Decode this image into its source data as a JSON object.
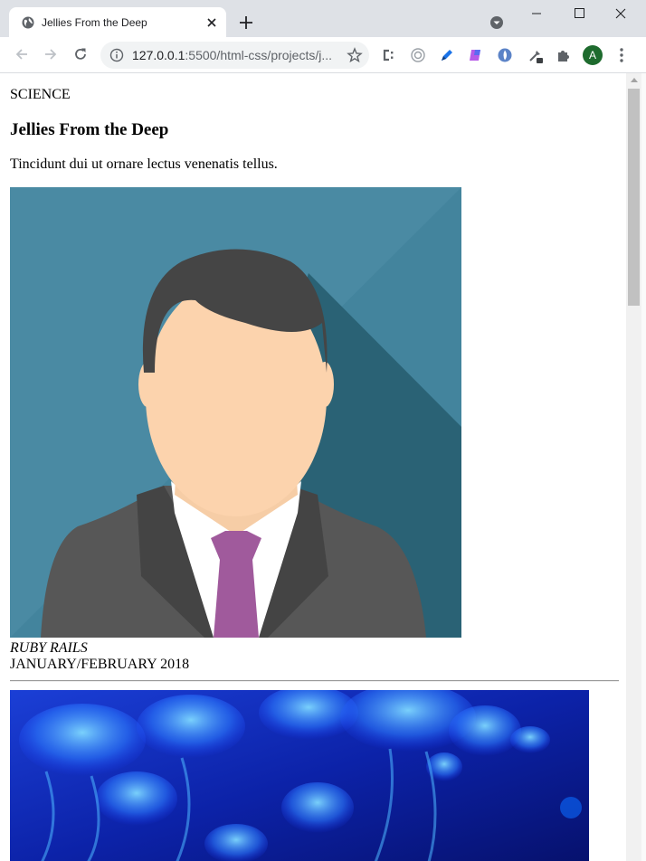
{
  "browser": {
    "tab_title": "Jellies From the Deep",
    "url_host": "127.0.0.1",
    "url_rest": ":5500/html-css/projects/j...",
    "profile_initial": "A",
    "icons": [
      "globe-icon",
      "close-icon",
      "plus-icon",
      "chevron-down-icon",
      "minimize-icon",
      "maximize-icon",
      "close-icon",
      "back-arrow-icon",
      "forward-arrow-icon",
      "reload-icon",
      "info-icon",
      "star-icon",
      "css-extension-icon",
      "color-extension-icon",
      "pen-extension-icon",
      "gradient-extension-icon",
      "blue-extension-icon",
      "eyedropper-icon",
      "puzzle-icon",
      "kebab-menu-icon"
    ]
  },
  "article": {
    "category": "SCIENCE",
    "headline": "Jellies From the Deep",
    "subhead": "Tincidunt dui ut ornare lectus venenatis tellus.",
    "author_name": "RUBY RAILS",
    "issue_date": "JANUARY/FEBRUARY 2018"
  },
  "colors": {
    "avatar_bg": "#4a8aa3",
    "jelly_bg": "#0a1a8c",
    "tie": "#a05a9c"
  }
}
